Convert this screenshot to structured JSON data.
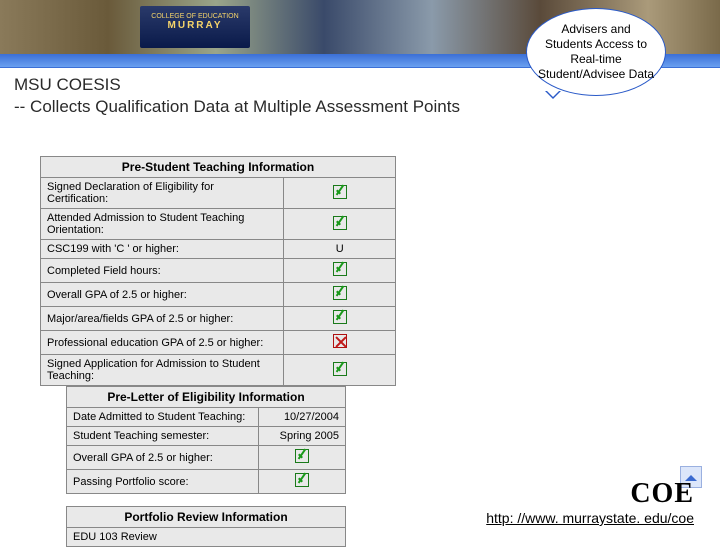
{
  "banner": {
    "logo_top": "COLLEGE OF EDUCATION",
    "logo_main": "MURRAY"
  },
  "callout": {
    "text": "Advisers and Students Access to Real-time Student/Advisee Data"
  },
  "title": {
    "line1": "MSU COESIS",
    "line2": "-- Collects Qualification Data at Multiple Assessment Points"
  },
  "left_table": {
    "header": "Pre-Student Teaching Information",
    "rows": [
      {
        "label": "Signed Declaration of Eligibility for Certification:",
        "status": "check"
      },
      {
        "label": "Attended Admission to Student Teaching Orientation:",
        "status": "check"
      },
      {
        "label": "CSC199 with 'C ' or higher:",
        "status": "text",
        "value": "U"
      },
      {
        "label": "Completed Field hours:",
        "status": "check"
      },
      {
        "label": "Overall GPA of 2.5 or higher:",
        "status": "check"
      },
      {
        "label": "Major/area/fields GPA of 2.5 or higher:",
        "status": "check"
      },
      {
        "label": "Professional education GPA of 2.5 or higher:",
        "status": "cross"
      },
      {
        "label": "Signed Application for Admission to Student Teaching:",
        "status": "check"
      }
    ]
  },
  "right_table": {
    "header": "Pre-Letter of Eligibility Information",
    "rows": [
      {
        "label": "Date Admitted to Student Teaching:",
        "value": "10/27/2004"
      },
      {
        "label": "Student Teaching semester:",
        "value": "Spring 2005"
      },
      {
        "label": "Overall GPA of 2.5 or higher:",
        "status": "check"
      },
      {
        "label": "Passing Portfolio score:",
        "status": "check"
      }
    ]
  },
  "portfolio": {
    "header": "Portfolio Review Information",
    "row": "EDU 103 Review"
  },
  "footer": {
    "coe": "COE",
    "url": "http: //www. murraystate. edu/coe"
  }
}
